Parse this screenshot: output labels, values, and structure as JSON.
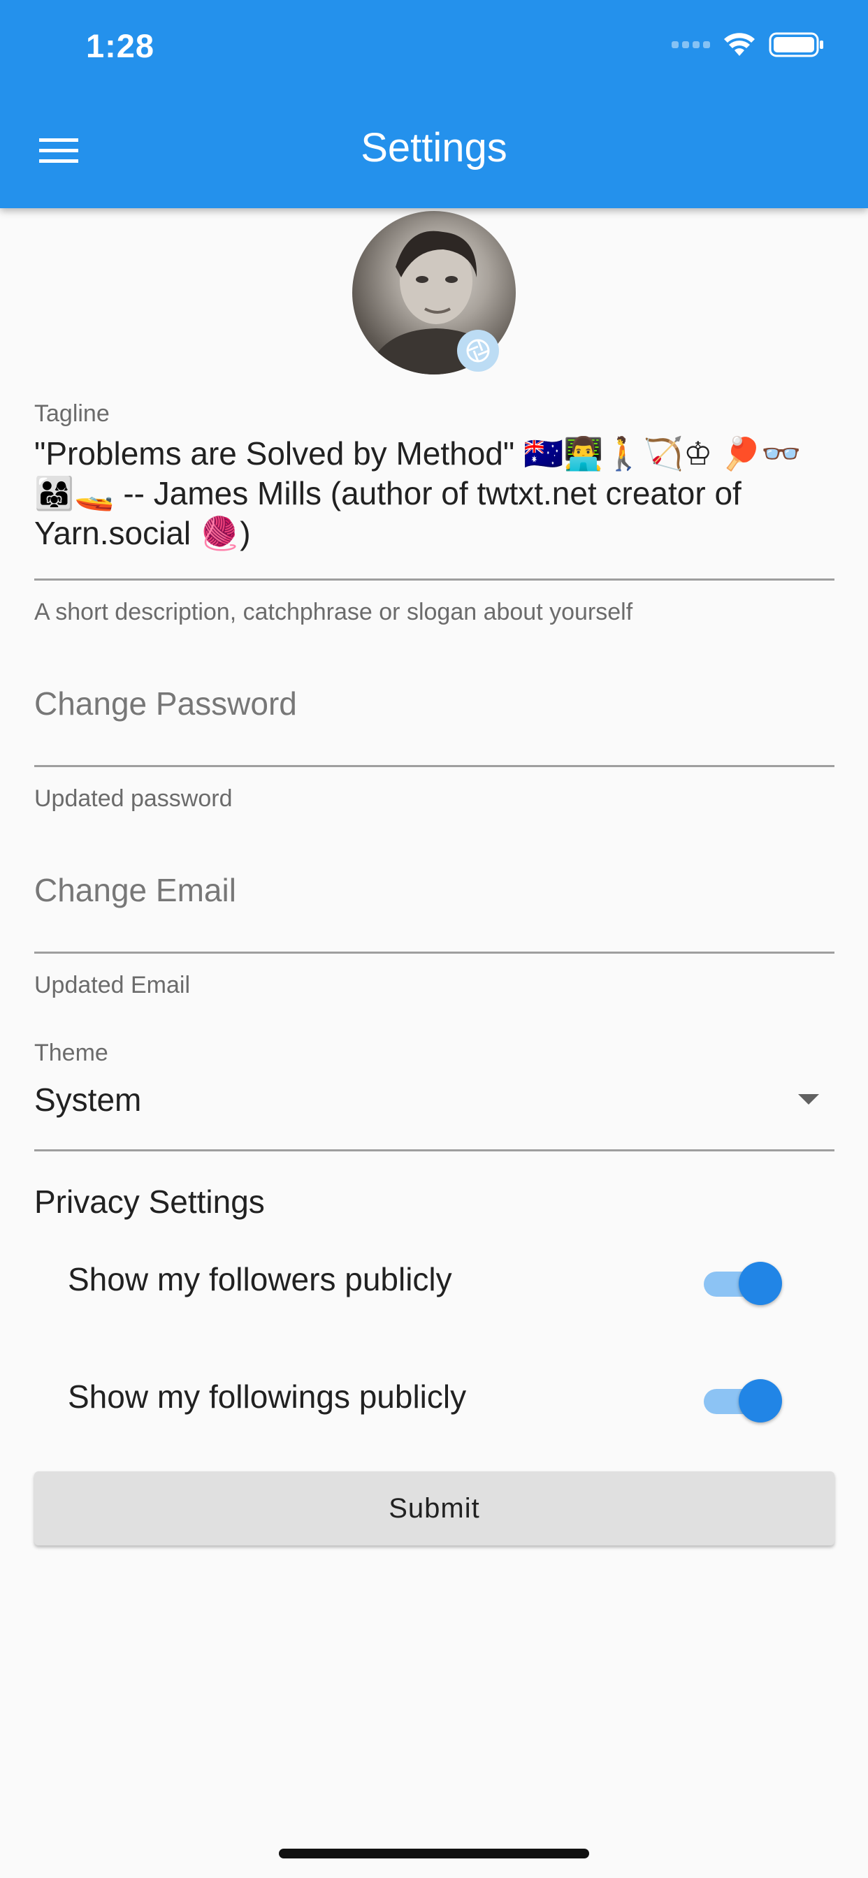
{
  "status_bar": {
    "time": "1:28"
  },
  "app_bar": {
    "title": "Settings",
    "menu_icon": "hamburger-menu-icon",
    "background": "#2491ec"
  },
  "tagline": {
    "label": "Tagline",
    "value_line1": "\"Problems are Solved by Method\" 🇦🇺👨‍💻🚶🏹♔ 🏓👓",
    "value_line2": "👨‍👩‍👧🚤 -- James Mills (author of twtxt.net creator of",
    "value_line3": "Yarn.social 🧶)",
    "helper": "A short description, catchphrase or slogan about yourself"
  },
  "password": {
    "placeholder": "Change Password",
    "helper": "Updated password"
  },
  "email": {
    "placeholder": "Change Email",
    "helper": "Updated Email"
  },
  "theme": {
    "label": "Theme",
    "value": "System"
  },
  "privacy": {
    "title": "Privacy Settings",
    "followers_label": "Show my followers publicly",
    "followers_enabled": true,
    "followings_label": "Show my followings publicly",
    "followings_enabled": true
  },
  "submit_label": "Submit",
  "accent_color": "#2185e6"
}
